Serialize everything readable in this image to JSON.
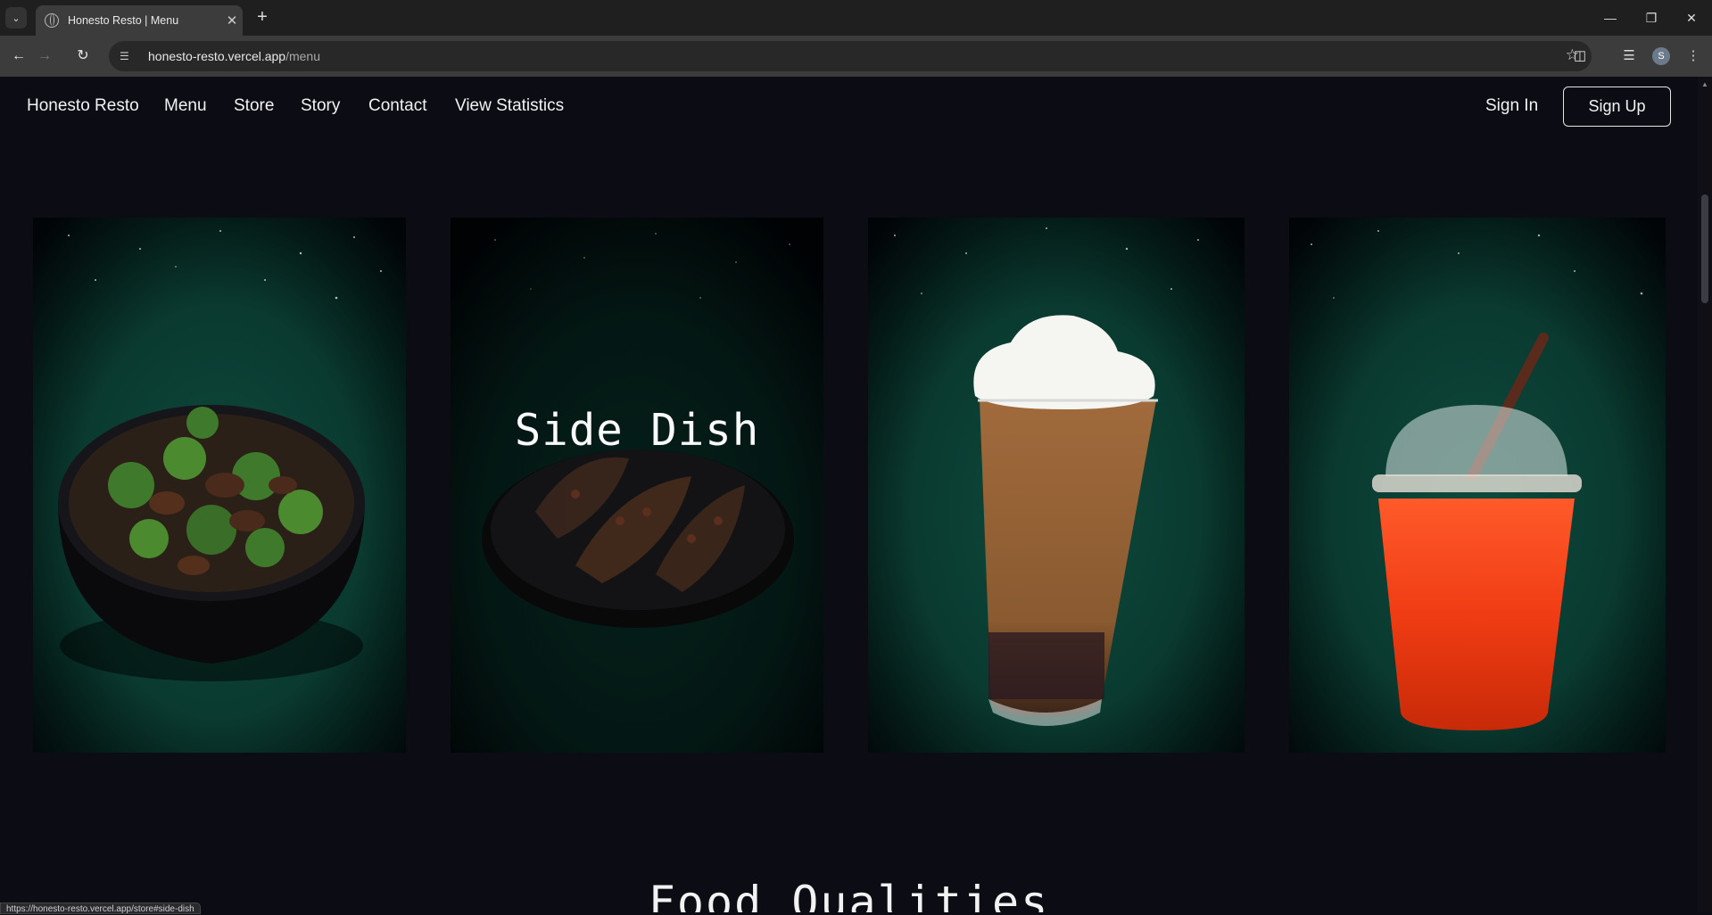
{
  "browser": {
    "tab_title": "Honesto Resto | Menu",
    "url_host": "honesto-resto.vercel.app",
    "url_path": "/menu",
    "profile_initial": "S",
    "status_url": "https://honesto-resto.vercel.app/store#side-dish"
  },
  "nav": {
    "brand": "Honesto Resto",
    "links": [
      "Menu",
      "Store",
      "Story",
      "Contact",
      "View Statistics"
    ],
    "sign_in": "Sign In",
    "sign_up": "Sign Up"
  },
  "menu_cards": [
    {
      "name": "beef-broccoli-bowl",
      "caption": ""
    },
    {
      "name": "side-dish",
      "caption": "Side Dish"
    },
    {
      "name": "iced-mocha-frappe",
      "caption": ""
    },
    {
      "name": "iced-red-tea",
      "caption": ""
    }
  ],
  "sections": {
    "food_qualities_title": "Food Qualities"
  },
  "colors": {
    "page_bg": "#0b0c14",
    "card_green": "#0b3b31",
    "card_dark": "#02060a"
  }
}
